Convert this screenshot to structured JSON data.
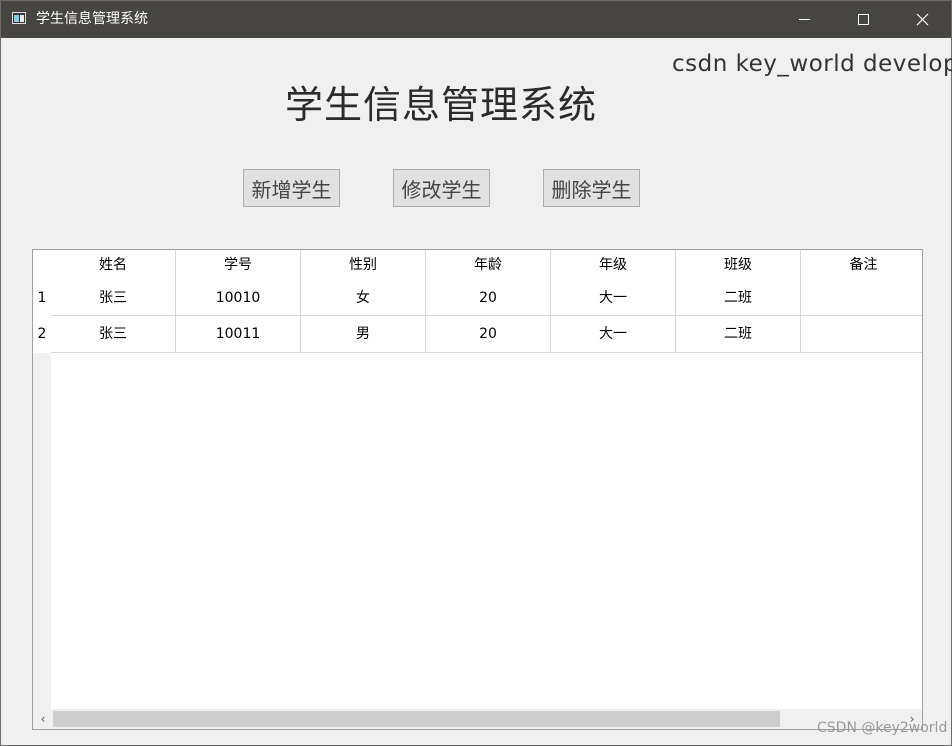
{
  "window": {
    "title": "学生信息管理系统",
    "controls": {
      "minimize": "minimize-icon",
      "maximize": "maximize-icon",
      "close": "close-icon"
    }
  },
  "header": {
    "watermark": "csdn key_world develop",
    "title": "学生信息管理系统"
  },
  "actions": {
    "add": "新增学生",
    "edit": "修改学生",
    "delete": "删除学生"
  },
  "table": {
    "columns": [
      "姓名",
      "学号",
      "性别",
      "年龄",
      "年级",
      "班级",
      "备注"
    ],
    "rows": [
      {
        "num": "1",
        "cells": [
          "张三",
          "10010",
          "女",
          "20",
          "大一",
          "二班",
          ""
        ]
      },
      {
        "num": "2",
        "cells": [
          "张三",
          "10011",
          "男",
          "20",
          "大一",
          "二班",
          ""
        ]
      }
    ],
    "scroll_left": "‹",
    "scroll_right": "›"
  },
  "footer": {
    "watermark": "CSDN @key2world"
  }
}
